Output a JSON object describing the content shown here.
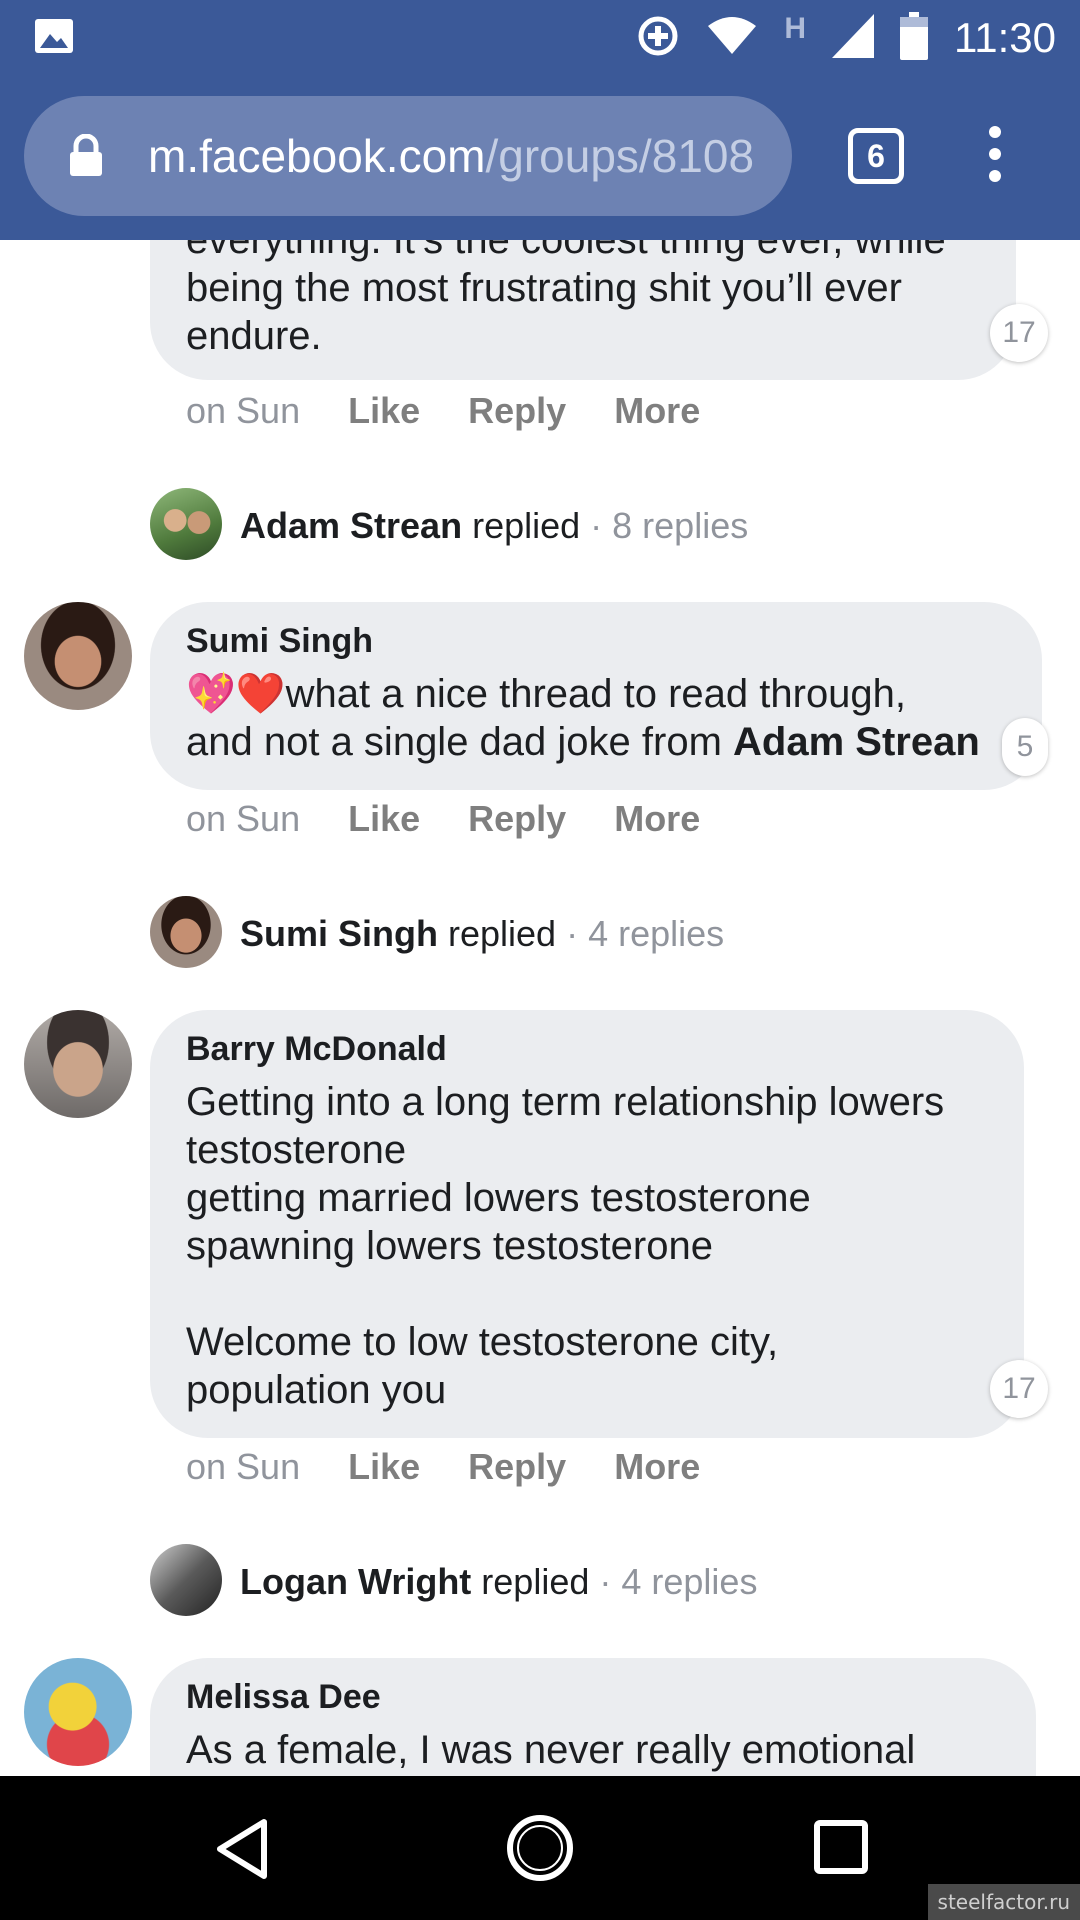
{
  "status_bar": {
    "time": "11:30",
    "network_letter": "H"
  },
  "browser": {
    "url_host": "m.facebook.com",
    "url_path": "/groups/8108",
    "tab_count": "6"
  },
  "comments": [
    {
      "id": "partial",
      "author": "",
      "lines_top": "everything. It’s the coolest thing ever, while",
      "text": "being the most frustrating shit you’ll ever\nendure.",
      "reactions": "17",
      "time": "on Sun"
    },
    {
      "id": "sumi",
      "author": "Sumi Singh",
      "text_before": "what a nice thread to read through,\nand not a single dad joke from ",
      "text_bold": "Adam Strean",
      "reactions": "5",
      "time": "on Sun"
    },
    {
      "id": "barry",
      "author": "Barry McDonald",
      "text": "Getting into a long term relationship lowers\ntestosterone\ngetting married lowers testosterone\nspawning lowers testosterone\n\nWelcome to low testosterone city,\npopulation you",
      "reactions": "17",
      "time": "on Sun"
    },
    {
      "id": "melissa",
      "author": "Melissa Dee",
      "text": "As a female, I was never really emotional"
    }
  ],
  "actions": {
    "like": "Like",
    "reply": "Reply",
    "more": "More"
  },
  "replies": [
    {
      "name": "Adam Strean",
      "verb": "replied",
      "count": "· 8 replies"
    },
    {
      "name": "Sumi Singh",
      "verb": "replied",
      "count": "· 4 replies"
    },
    {
      "name": "Logan Wright",
      "verb": "replied",
      "count": "· 4 replies"
    }
  ],
  "watermark": "steelfactor.ru",
  "colors": {
    "facebook_blue": "#3b5998",
    "bubble": "#ebedf0",
    "meta_gray": "#90949c"
  }
}
